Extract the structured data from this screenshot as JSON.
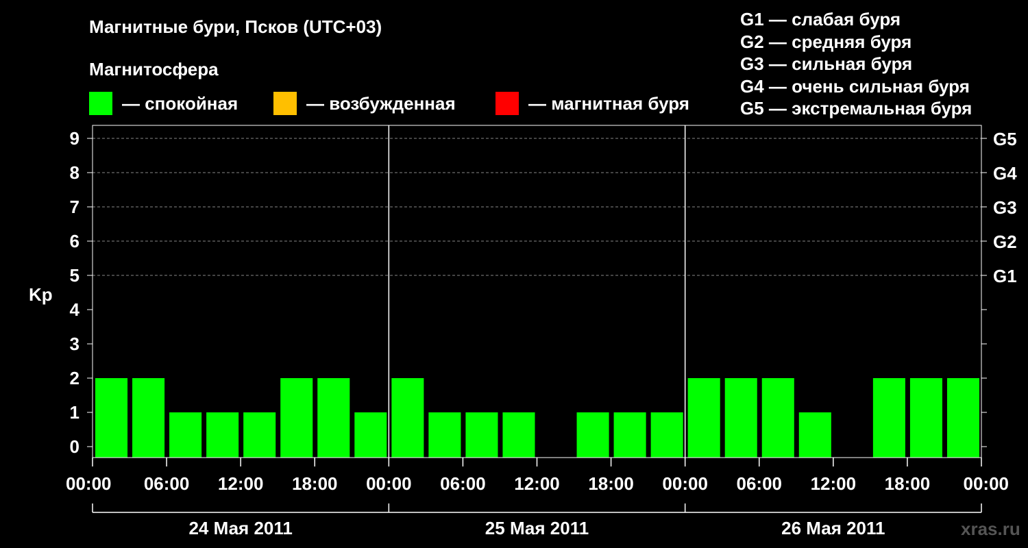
{
  "header": {
    "title": "Магнитные бури, Псков (UTC+03)",
    "subtitle": "Магнитосфера"
  },
  "legend": [
    {
      "label": "— спокойная",
      "color": "#00ff00"
    },
    {
      "label": "— возбужденная",
      "color": "#ffbf00"
    },
    {
      "label": "— магнитная буря",
      "color": "#ff0000"
    }
  ],
  "g_scale": [
    "G1 — слабая буря",
    "G2 — средняя буря",
    "G3 — сильная буря",
    "G4 — очень сильная буря",
    "G5 — экстремальная буря"
  ],
  "brand": "xras.ru",
  "chart_data": {
    "type": "bar",
    "ylabel": "Kp",
    "ylim": [
      0,
      9
    ],
    "y_ticks": [
      "0",
      "1",
      "2",
      "3",
      "4",
      "5",
      "6",
      "7",
      "8",
      "9"
    ],
    "g_levels": [
      {
        "label": "G1",
        "kp": 5
      },
      {
        "label": "G2",
        "kp": 6
      },
      {
        "label": "G3",
        "kp": 7
      },
      {
        "label": "G4",
        "kp": 8
      },
      {
        "label": "G5",
        "kp": 9
      }
    ],
    "x_tick_labels": [
      "00:00",
      "06:00",
      "12:00",
      "18:00",
      "00:00",
      "06:00",
      "12:00",
      "18:00",
      "00:00",
      "06:00",
      "12:00",
      "18:00",
      "00:00"
    ],
    "days": [
      "24 Мая 2011",
      "25 Мая 2011",
      "26 Мая 2011"
    ],
    "bar_interval_hours": 3,
    "values": [
      2,
      2,
      1,
      1,
      1,
      2,
      2,
      1,
      2,
      1,
      1,
      1,
      0,
      1,
      1,
      1,
      2,
      2,
      2,
      1,
      0,
      2,
      2,
      2
    ],
    "bar_color": "#00ff00",
    "grid": true
  }
}
